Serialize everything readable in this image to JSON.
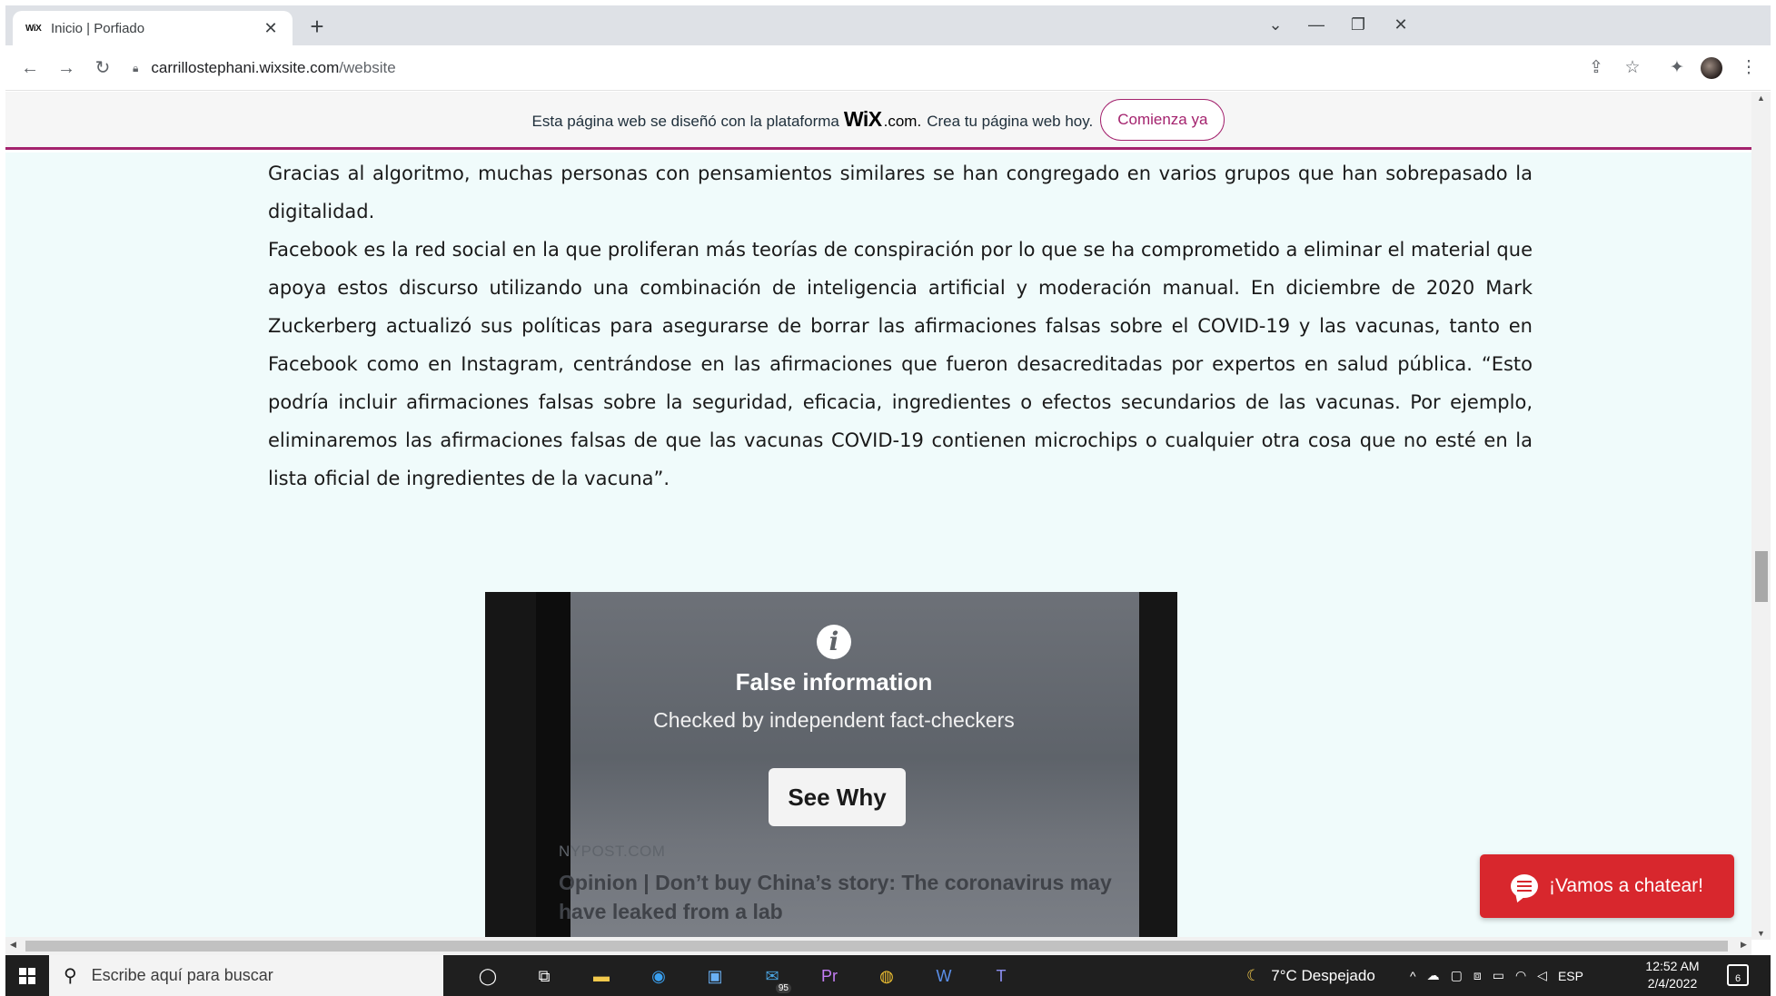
{
  "browser": {
    "tab": {
      "favicon": "WiX",
      "title": "Inicio | Porfiado"
    },
    "new_tab_label": "+",
    "window_controls": {
      "dropdown": "⌄",
      "minimize": "—",
      "restore": "❐",
      "close": "✕"
    },
    "address": {
      "host": "carrillostephani.wixsite.com",
      "path": "/website"
    },
    "icons": [
      "back-icon",
      "forward-icon",
      "reload-icon",
      "lock-icon",
      "share-icon",
      "star-icon",
      "extensions-icon",
      "profile-avatar",
      "more-icon"
    ]
  },
  "wix_banner": {
    "text_before": "Esta página web se diseñó con la plataforma",
    "logo": "WiX",
    "logo_suffix": ".com.",
    "text_after": "Crea tu página web hoy.",
    "cta": "Comienza ya",
    "accent_color": "#a4236e"
  },
  "article": {
    "paragraphs": [
      "Gracias al algoritmo, muchas personas con pensamientos similares se han congregado en varios grupos que han sobrepasado la digitalidad.",
      "Facebook es la red social en la que proliferan más teorías de conspiración por lo que se ha comprometido a eliminar el material que apoya estos discurso utilizando una combinación de inteligencia artificial y moderación manual. En diciembre de 2020 Mark Zuckerberg actualizó sus políticas para asegurarse de borrar las afirmaciones falsas sobre el COVID-19 y las vacunas, tanto en Facebook como en Instagram, centrándose en las afirmaciones que fueron desacreditadas por expertos en salud pública. “Esto podría incluir afirmaciones falsas sobre la seguridad, eficacia, ingredientes o efectos secundarios de las vacunas. Por ejemplo, eliminaremos las afirmaciones falsas de que las vacunas COVID-19 contienen microchips o cualquier otra cosa que no esté en la lista oficial de ingredientes de la vacuna”."
    ]
  },
  "video": {
    "info_glyph": "i",
    "title": "False information",
    "subtitle": "Checked by independent fact-checkers",
    "button": "See Why",
    "source": "NYPOST.COM",
    "headline": "Opinion | Don’t buy China’s story: The coronavirus may have leaked from a lab"
  },
  "chat": {
    "label": "¡Vamos a chatear!",
    "color": "#d8272d"
  },
  "taskbar": {
    "search_placeholder": "Escribe aquí para buscar",
    "apps": [
      "cortana-icon",
      "task-view-icon",
      "file-explorer-icon",
      "edge-icon",
      "store-icon",
      "mail-icon",
      "premiere-icon",
      "chrome-icon",
      "word-icon",
      "teams-icon"
    ],
    "mail_badge": "95",
    "weather": "7°C  Despejado",
    "language": "ESP",
    "time": "12:52 AM",
    "date": "2/4/2022",
    "notifications": "6"
  }
}
